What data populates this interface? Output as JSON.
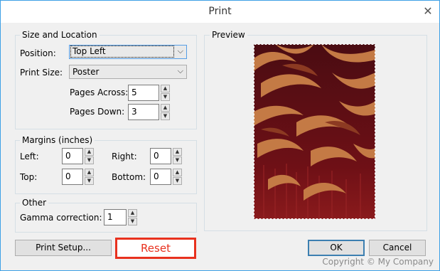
{
  "window": {
    "title": "Print",
    "close_symbol": "✕"
  },
  "size_location": {
    "group_label": "Size and Location",
    "position_label": "Position:",
    "position_value": "Top Left",
    "print_size_label": "Print Size:",
    "print_size_value": "Poster",
    "pages_across_label": "Pages Across:",
    "pages_across_value": "5",
    "pages_down_label": "Pages Down:",
    "pages_down_value": "3"
  },
  "margins": {
    "group_label": "Margins (inches)",
    "left_label": "Left:",
    "left_value": "0",
    "right_label": "Right:",
    "right_value": "0",
    "top_label": "Top:",
    "top_value": "0",
    "bottom_label": "Bottom:",
    "bottom_value": "0"
  },
  "other": {
    "group_label": "Other",
    "gamma_label": "Gamma correction:",
    "gamma_value": "1"
  },
  "preview": {
    "group_label": "Preview"
  },
  "buttons": {
    "print_setup": "Print Setup...",
    "reset": "Reset",
    "ok": "OK",
    "cancel": "Cancel"
  },
  "watermark": "Copyright © My Company",
  "colors": {
    "accent": "#3ea0e6",
    "highlight": "#e8311e",
    "preview_base": "#6e1016",
    "preview_swirl": "#c47a45"
  },
  "icons": {
    "dropdown": "chevron-down-icon",
    "spin_up": "triangle-up-icon",
    "spin_down": "triangle-down-icon"
  }
}
